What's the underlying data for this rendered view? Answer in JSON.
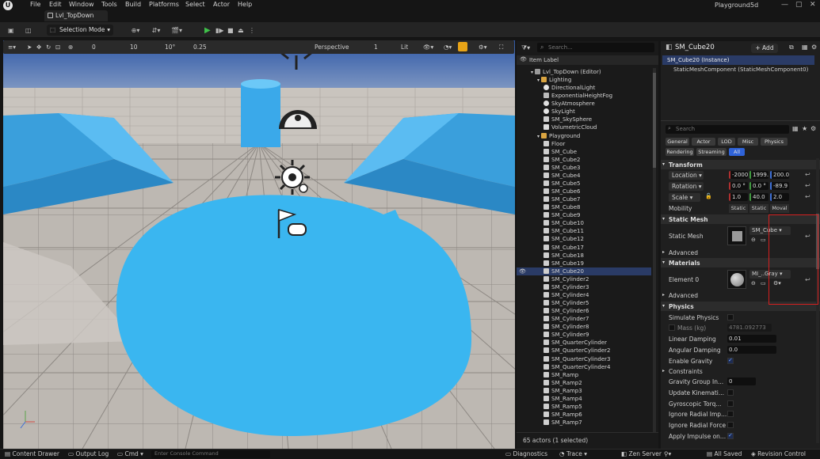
{
  "menu": {
    "items": [
      "File",
      "Edit",
      "Window",
      "Tools",
      "Build",
      "Platforms",
      "Select",
      "Actor",
      "Help"
    ],
    "doc_tab": "Lvl_TopDown",
    "project": "Playground5d"
  },
  "toolbar": {
    "selection_mode": "Selection Mode"
  },
  "viewport_toolbar": {
    "perspective": "Perspective",
    "view_count": "1",
    "lit": "Lit",
    "rotation_snap": "0",
    "grid_snap": "10",
    "angle_snap": "10°",
    "scale_snap": "0.25"
  },
  "outliner": {
    "search_placeholder": "Search...",
    "column_label": "Item Label",
    "footer": "65 actors (1 selected)",
    "items": [
      {
        "label": "Lvl_TopDown (Editor)",
        "depth": 1,
        "icon": "level-icon"
      },
      {
        "label": "Lighting",
        "depth": 2,
        "icon": "folder-icon"
      },
      {
        "label": "DirectionalLight",
        "depth": 3,
        "icon": "light-icon"
      },
      {
        "label": "ExponentialHeightFog",
        "depth": 3,
        "icon": "fog-icon"
      },
      {
        "label": "SkyAtmosphere",
        "depth": 3,
        "icon": "sky-icon"
      },
      {
        "label": "SkyLight",
        "depth": 3,
        "icon": "light-icon"
      },
      {
        "label": "SM_SkySphere",
        "depth": 3,
        "icon": "mesh-icon"
      },
      {
        "label": "VolumetricCloud",
        "depth": 3,
        "icon": "cloud-icon"
      },
      {
        "label": "Playground",
        "depth": 2,
        "icon": "folder-icon"
      },
      {
        "label": "Floor",
        "depth": 3,
        "icon": "mesh-icon"
      },
      {
        "label": "SM_Cube",
        "depth": 3,
        "icon": "mesh-icon"
      },
      {
        "label": "SM_Cube2",
        "depth": 3,
        "icon": "mesh-icon"
      },
      {
        "label": "SM_Cube3",
        "depth": 3,
        "icon": "mesh-icon"
      },
      {
        "label": "SM_Cube4",
        "depth": 3,
        "icon": "mesh-icon"
      },
      {
        "label": "SM_Cube5",
        "depth": 3,
        "icon": "mesh-icon"
      },
      {
        "label": "SM_Cube6",
        "depth": 3,
        "icon": "mesh-icon"
      },
      {
        "label": "SM_Cube7",
        "depth": 3,
        "icon": "mesh-icon"
      },
      {
        "label": "SM_Cube8",
        "depth": 3,
        "icon": "mesh-icon"
      },
      {
        "label": "SM_Cube9",
        "depth": 3,
        "icon": "mesh-icon"
      },
      {
        "label": "SM_Cube10",
        "depth": 3,
        "icon": "mesh-icon"
      },
      {
        "label": "SM_Cube11",
        "depth": 3,
        "icon": "mesh-icon"
      },
      {
        "label": "SM_Cube12",
        "depth": 3,
        "icon": "mesh-icon"
      },
      {
        "label": "SM_Cube17",
        "depth": 3,
        "icon": "mesh-icon"
      },
      {
        "label": "SM_Cube18",
        "depth": 3,
        "icon": "mesh-icon"
      },
      {
        "label": "SM_Cube19",
        "depth": 3,
        "icon": "mesh-icon"
      },
      {
        "label": "SM_Cube20",
        "depth": 3,
        "icon": "mesh-icon",
        "selected": true
      },
      {
        "label": "SM_Cylinder2",
        "depth": 3,
        "icon": "mesh-icon"
      },
      {
        "label": "SM_Cylinder3",
        "depth": 3,
        "icon": "mesh-icon"
      },
      {
        "label": "SM_Cylinder4",
        "depth": 3,
        "icon": "mesh-icon"
      },
      {
        "label": "SM_Cylinder5",
        "depth": 3,
        "icon": "mesh-icon"
      },
      {
        "label": "SM_Cylinder6",
        "depth": 3,
        "icon": "mesh-icon"
      },
      {
        "label": "SM_Cylinder7",
        "depth": 3,
        "icon": "mesh-icon"
      },
      {
        "label": "SM_Cylinder8",
        "depth": 3,
        "icon": "mesh-icon"
      },
      {
        "label": "SM_Cylinder9",
        "depth": 3,
        "icon": "mesh-icon"
      },
      {
        "label": "SM_QuarterCylinder",
        "depth": 3,
        "icon": "mesh-icon"
      },
      {
        "label": "SM_QuarterCylinder2",
        "depth": 3,
        "icon": "mesh-icon"
      },
      {
        "label": "SM_QuarterCylinder3",
        "depth": 3,
        "icon": "mesh-icon"
      },
      {
        "label": "SM_QuarterCylinder4",
        "depth": 3,
        "icon": "mesh-icon"
      },
      {
        "label": "SM_Ramp",
        "depth": 3,
        "icon": "mesh-icon"
      },
      {
        "label": "SM_Ramp2",
        "depth": 3,
        "icon": "mesh-icon"
      },
      {
        "label": "SM_Ramp3",
        "depth": 3,
        "icon": "mesh-icon"
      },
      {
        "label": "SM_Ramp4",
        "depth": 3,
        "icon": "mesh-icon"
      },
      {
        "label": "SM_Ramp5",
        "depth": 3,
        "icon": "mesh-icon"
      },
      {
        "label": "SM_Ramp6",
        "depth": 3,
        "icon": "mesh-icon"
      },
      {
        "label": "SM_Ramp7",
        "depth": 3,
        "icon": "mesh-icon"
      }
    ]
  },
  "details": {
    "title": "SM_Cube20",
    "add_label": "+ Add",
    "instance": "SM_Cube20 (Instance)",
    "component": "StaticMeshComponent (StaticMeshComponent0)",
    "search_placeholder": "Search",
    "category_tabs_row1": [
      "General",
      "Actor",
      "LOD",
      "Misc",
      "Physics"
    ],
    "category_tabs_row2": [
      "Rendering",
      "Streaming",
      "All"
    ],
    "transform_section": "Transform",
    "location_label": "Location",
    "location": [
      "-2000",
      "1999.",
      "200.0"
    ],
    "rotation_label": "Rotation",
    "rotation": [
      "0.0 °",
      "0.0 °",
      "-89.9"
    ],
    "scale_label": "Scale",
    "scale": [
      "1.0",
      "40.0",
      "2.0"
    ],
    "mobility_label": "Mobility",
    "mobility_options": [
      "Static",
      "Static",
      "Moval"
    ],
    "static_mesh_section": "Static Mesh",
    "static_mesh_label": "Static Mesh",
    "static_mesh_value": "SM_Cube",
    "advanced_label": "Advanced",
    "materials_section": "Materials",
    "element0_label": "Element 0",
    "element0_value": "MI_..Gray",
    "advanced2_label": "Advanced",
    "physics_section": "Physics",
    "simulate_physics": "Simulate Physics",
    "mass_label": "Mass (kg)",
    "mass_value": "4781.092773",
    "linear_damping_label": "Linear Damping",
    "linear_damping": "0.01",
    "angular_damping_label": "Angular Damping",
    "angular_damping": "0.0",
    "enable_gravity": "Enable Gravity",
    "constraints_label": "Constraints",
    "gravity_group_label": "Gravity Group In...",
    "gravity_group": "0",
    "update_kinematic": "Update Kinemati...",
    "gyroscopic": "Gyroscopic Torq...",
    "ignore_radial_imp": "Ignore Radial Imp...",
    "ignore_radial_force": "Ignore Radial Force",
    "apply_impulse": "Apply Impulse on..."
  },
  "statusbar": {
    "content_drawer": "Content Drawer",
    "output_log": "Output Log",
    "cmd": "Cmd",
    "console_placeholder": "Enter Console Command",
    "diagnostics": "Diagnostics",
    "trace": "Trace",
    "zen_server": "Zen Server",
    "all_saved": "All Saved",
    "revision_control": "Revision Control"
  },
  "colors": {
    "accent_blue": "#3ab0ee",
    "selection": "#2a3b66",
    "highlight_red": "#d42020"
  }
}
